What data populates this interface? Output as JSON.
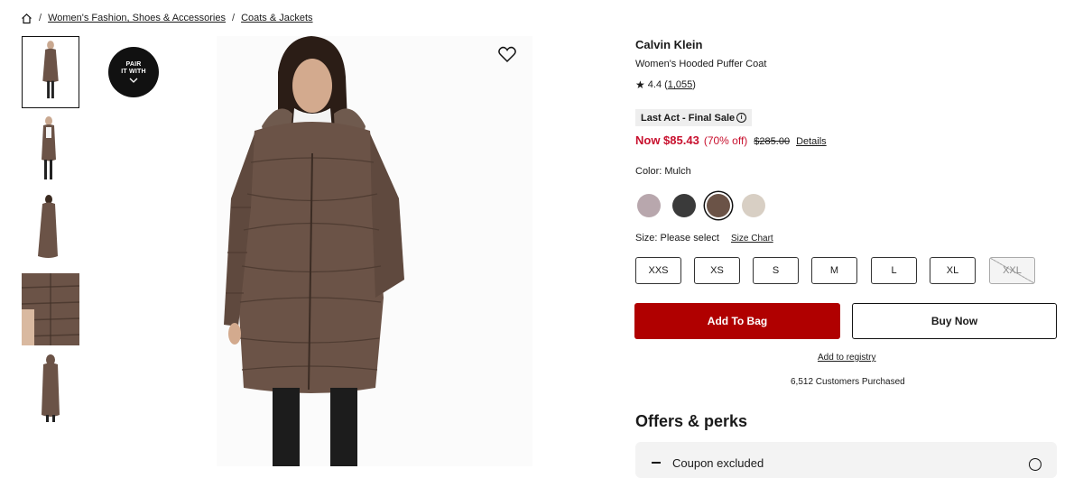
{
  "breadcrumb": {
    "home_icon": "home-icon",
    "sep": "/",
    "items": [
      "Women's Fashion, Shoes & Accessories",
      "Coats & Jackets"
    ]
  },
  "pair_badge": {
    "line1": "PAIR",
    "line2": "IT WITH"
  },
  "product": {
    "brand": "Calvin Klein",
    "name": "Women's Hooded Puffer Coat",
    "rating": "4.4",
    "review_count": "1,055",
    "sale_badge": "Last Act - Final Sale",
    "price_now": "Now $85.43",
    "price_off": "(70% off)",
    "price_original": "$285.00",
    "details_link": "Details"
  },
  "color": {
    "label": "Color: Mulch",
    "swatches": [
      {
        "name": "Mauve",
        "hex": "#b8a7ad"
      },
      {
        "name": "Black",
        "hex": "#3a3a3a"
      },
      {
        "name": "Mulch",
        "hex": "#6b5347"
      },
      {
        "name": "Cream",
        "hex": "#d8cfc4"
      }
    ],
    "selected": "Mulch"
  },
  "size": {
    "label": "Size: Please select",
    "chart_link": "Size Chart",
    "options": [
      "XXS",
      "XS",
      "S",
      "M",
      "L",
      "XL",
      "XXL"
    ],
    "unavailable": [
      "XXL"
    ]
  },
  "actions": {
    "add_to_bag": "Add To Bag",
    "buy_now": "Buy Now",
    "registry": "Add to registry",
    "purchased": "6,512 Customers Purchased"
  },
  "offers": {
    "title": "Offers & perks",
    "coupon": "Coupon excluded"
  },
  "colors": {
    "accent_red": "#b00000",
    "price_red": "#c8102e",
    "coat": "#6b5347"
  }
}
